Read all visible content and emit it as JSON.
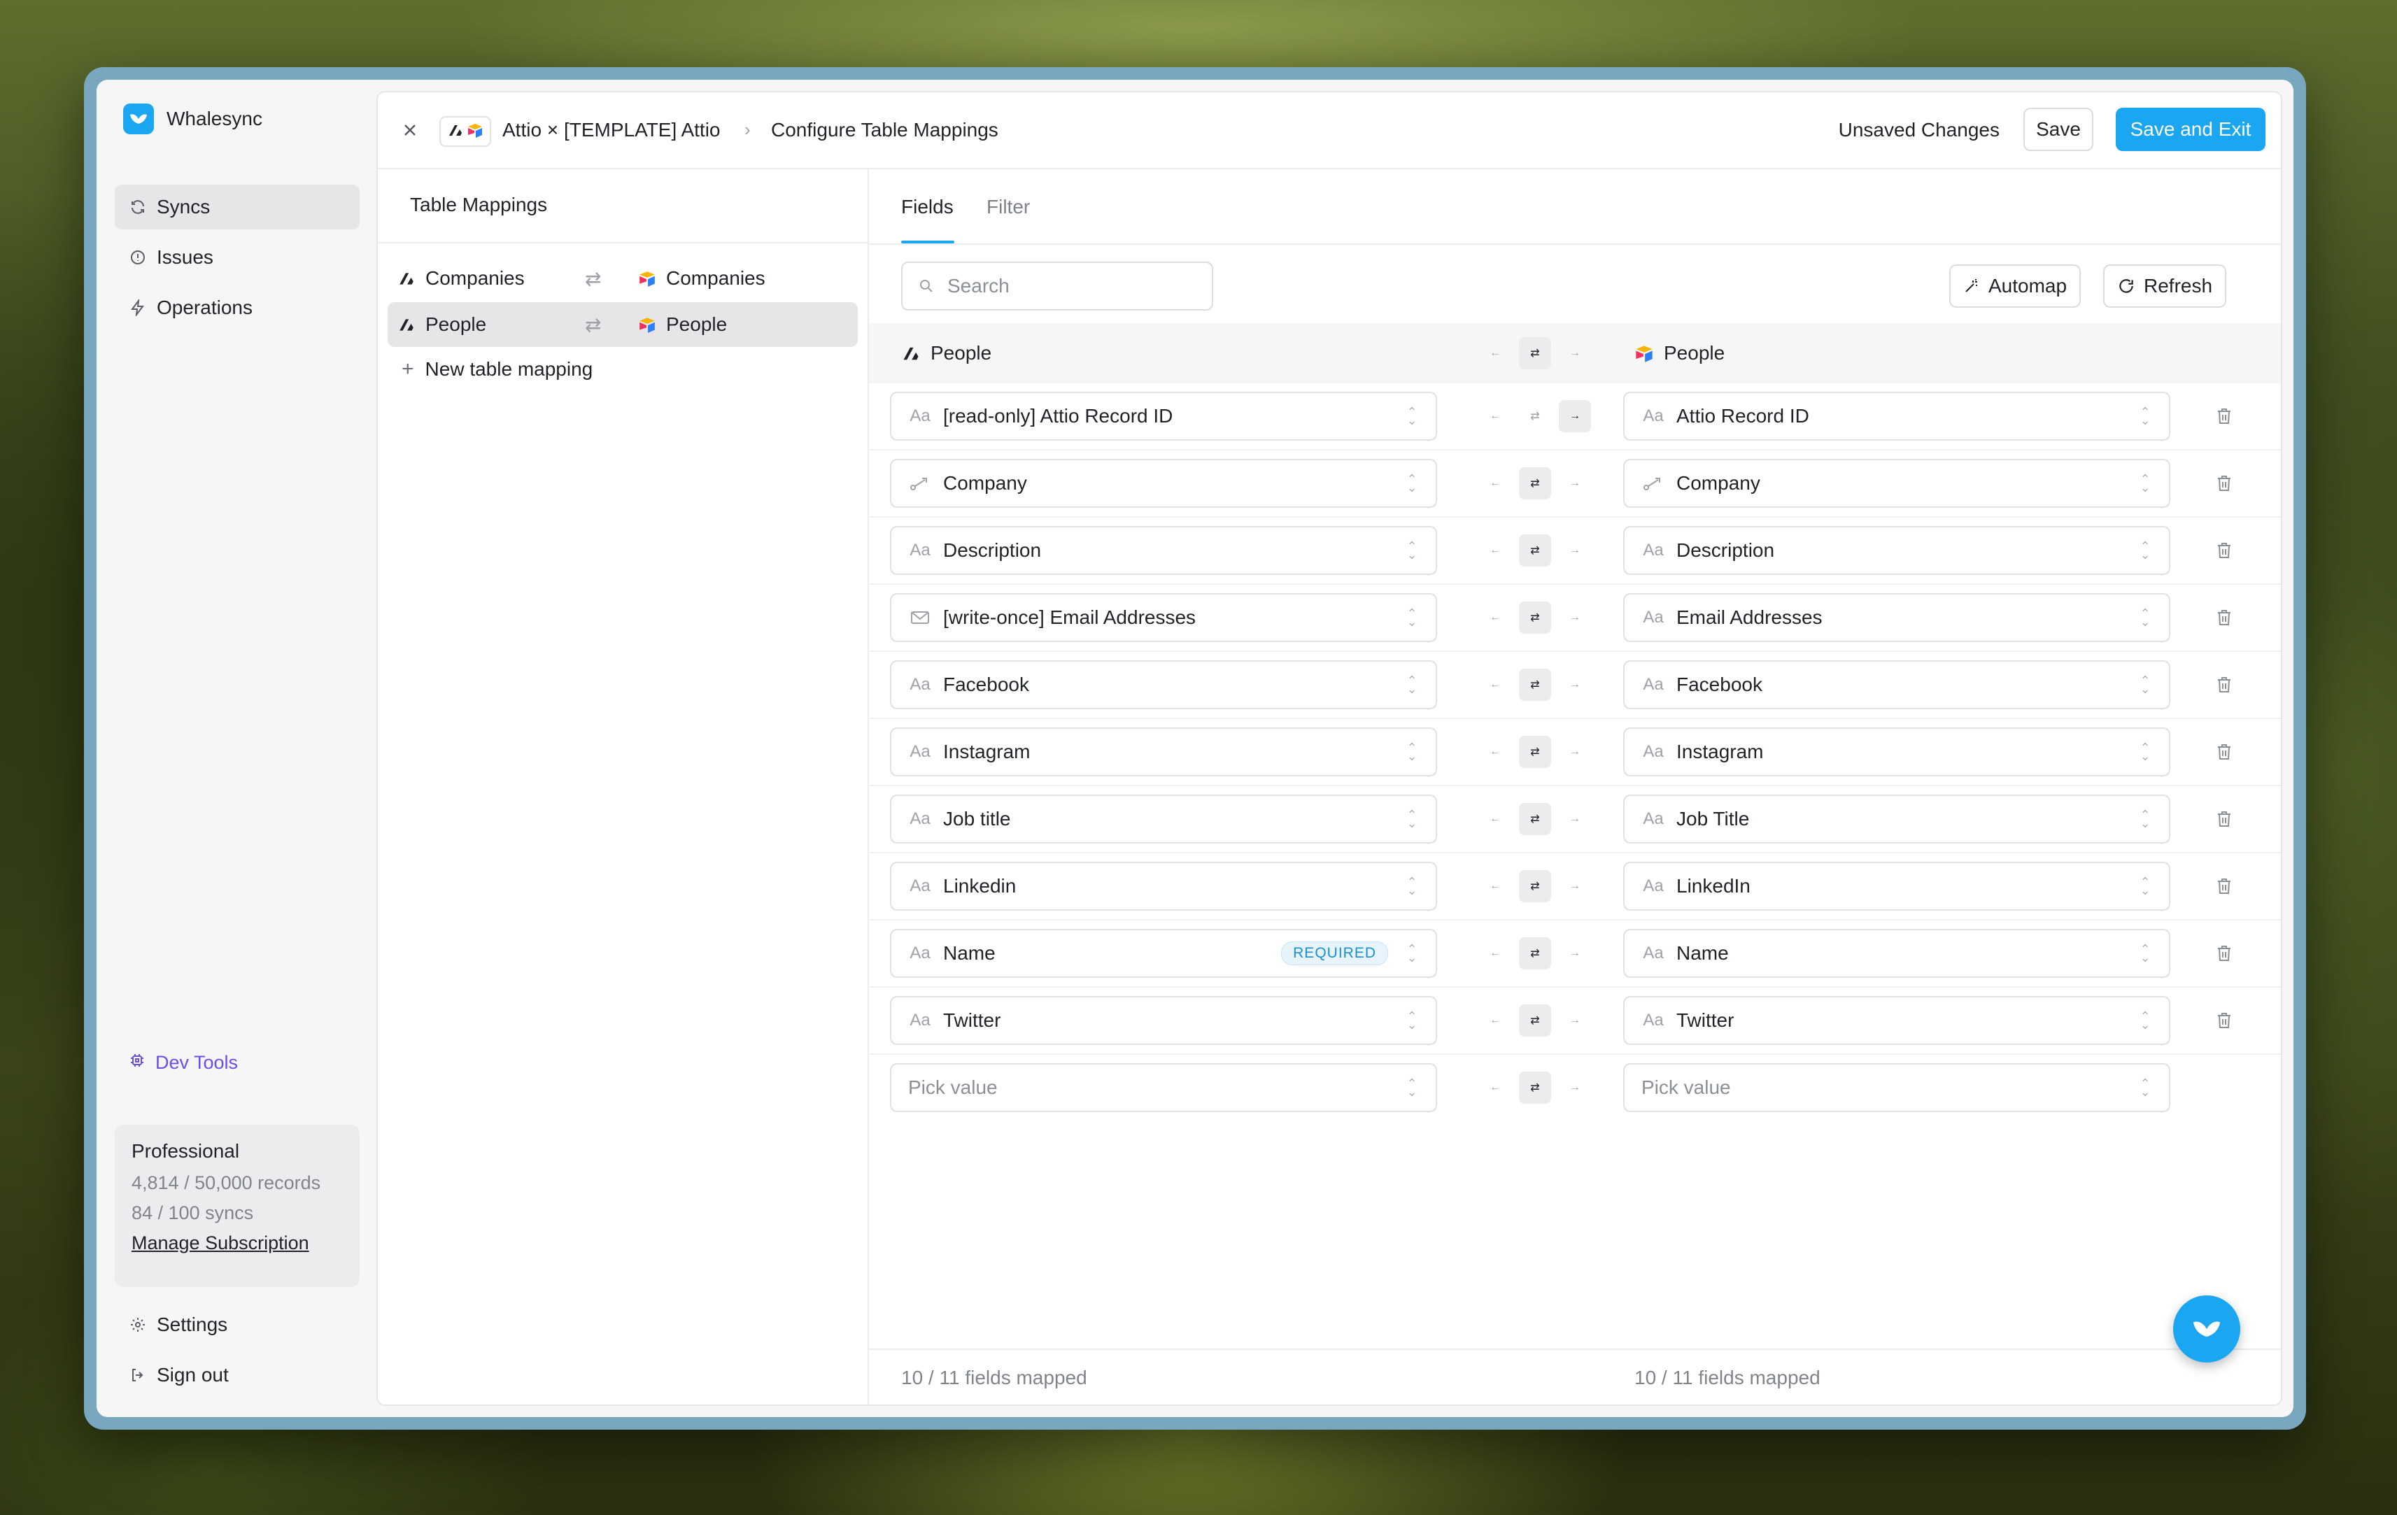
{
  "brand": {
    "name": "Whalesync"
  },
  "sidebar": {
    "items": [
      {
        "label": "Syncs",
        "icon": "refresh-icon",
        "active": true
      },
      {
        "label": "Issues",
        "icon": "alert-circle-icon",
        "active": false
      },
      {
        "label": "Operations",
        "icon": "bolt-icon",
        "active": false
      }
    ],
    "dev_tools": "Dev Tools",
    "plan": {
      "name": "Professional",
      "records": "4,814 / 50,000 records",
      "syncs": "84 / 100 syncs",
      "manage": "Manage Subscription"
    },
    "settings": "Settings",
    "sign_out": "Sign out"
  },
  "topbar": {
    "breadcrumb_base": "Attio × [TEMPLATE] Attio",
    "breadcrumb_current": "Configure Table Mappings",
    "status": "Unsaved Changes",
    "save": "Save",
    "save_exit": "Save and Exit"
  },
  "table_mappings": {
    "title": "Table Mappings",
    "rows": [
      {
        "left": "Companies",
        "right": "Companies",
        "active": false
      },
      {
        "left": "People",
        "right": "People",
        "active": true
      }
    ],
    "new_label": "New table mapping"
  },
  "tabs": [
    {
      "label": "Fields",
      "active": true
    },
    {
      "label": "Filter",
      "active": false
    }
  ],
  "toolbar": {
    "search_placeholder": "Search",
    "automap": "Automap",
    "refresh": "Refresh"
  },
  "mapping_header": {
    "left": "People",
    "right": "People"
  },
  "field_rows": [
    {
      "left": "[read-only] Attio Record ID",
      "left_icon": "text-icon",
      "right": "Attio Record ID",
      "right_icon": "text-icon",
      "direction": "right"
    },
    {
      "left": "Company",
      "left_icon": "relation-icon",
      "right": "Company",
      "right_icon": "relation-icon",
      "direction": "both"
    },
    {
      "left": "Description",
      "left_icon": "text-icon",
      "right": "Description",
      "right_icon": "text-icon",
      "direction": "both"
    },
    {
      "left": "[write-once] Email Addresses",
      "left_icon": "mail-icon",
      "right": "Email Addresses",
      "right_icon": "text-icon",
      "direction": "both"
    },
    {
      "left": "Facebook",
      "left_icon": "text-icon",
      "right": "Facebook",
      "right_icon": "text-icon",
      "direction": "both"
    },
    {
      "left": "Instagram",
      "left_icon": "text-icon",
      "right": "Instagram",
      "right_icon": "text-icon",
      "direction": "both"
    },
    {
      "left": "Job title",
      "left_icon": "text-icon",
      "right": "Job Title",
      "right_icon": "text-icon",
      "direction": "both"
    },
    {
      "left": "Linkedin",
      "left_icon": "text-icon",
      "right": "LinkedIn",
      "right_icon": "text-icon",
      "direction": "both"
    },
    {
      "left": "Name",
      "left_icon": "text-icon",
      "left_badge": "REQUIRED",
      "right": "Name",
      "right_icon": "text-icon",
      "direction": "both"
    },
    {
      "left": "Twitter",
      "left_icon": "text-icon",
      "right": "Twitter",
      "right_icon": "text-icon",
      "direction": "both"
    }
  ],
  "pick_row": {
    "left_placeholder": "Pick value",
    "right_placeholder": "Pick value"
  },
  "text_icon_glyph": "Aa",
  "footer": {
    "left": "10 / 11 fields mapped",
    "right": "10 / 11 fields mapped"
  },
  "colors": {
    "accent": "#1ba6f2",
    "dev_tools": "#6a4ee6"
  }
}
